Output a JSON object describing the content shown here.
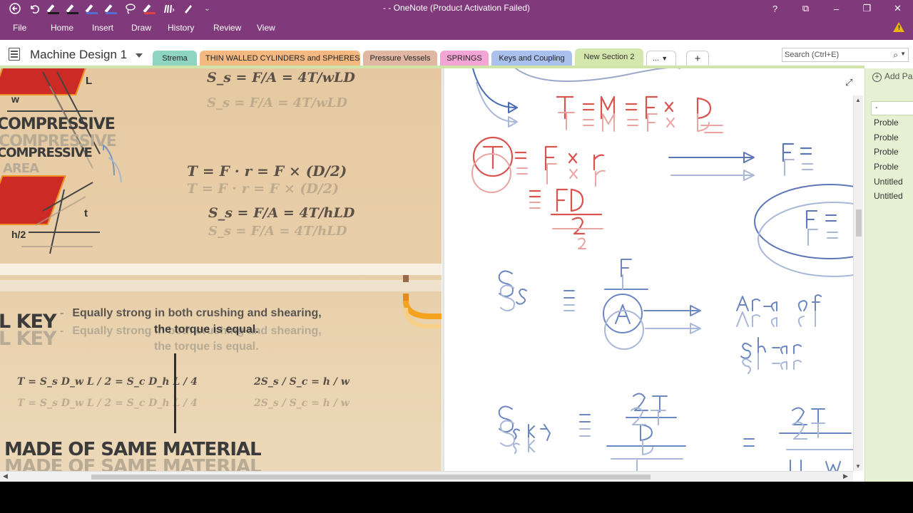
{
  "window": {
    "title": "- - OneNote (Product Activation Failed)",
    "controls": [
      "?",
      "⧉",
      "–",
      "❐",
      "✕"
    ]
  },
  "quick_access": {
    "back_icon": "back-icon",
    "undo_icon": "undo-icon",
    "pens": [
      {
        "color": "#1a1a1a"
      },
      {
        "color": "#1a1a1a"
      },
      {
        "color": "#4f6fd1"
      },
      {
        "color": "#4f6fd1"
      },
      {
        "color": "#1a1a1a"
      },
      {
        "color": "#e04040"
      }
    ]
  },
  "ribbon": {
    "tabs": [
      "File",
      "Home",
      "Insert",
      "Draw",
      "History",
      "Review",
      "View"
    ],
    "warning_icon": "warning-icon"
  },
  "notebook": {
    "name": "Machine Design 1"
  },
  "sections": [
    {
      "label": "Strema",
      "color": "#8fd3c1"
    },
    {
      "label": "THIN WALLED CYLINDERS and SPHERES",
      "color": "#f4b981"
    },
    {
      "label": "Pressure Vessels",
      "color": "#e0b7a2"
    },
    {
      "label": "SPRINGS",
      "color": "#f3a6d6"
    },
    {
      "label": "Keys and Coupling",
      "color": "#a9c1ec"
    },
    {
      "label": "New Section 2",
      "color": "#d4e8ae",
      "active": true
    }
  ],
  "section_more": "...",
  "add_section": "+",
  "search": {
    "placeholder": "Search (Ctrl+E)"
  },
  "slide": {
    "labels": {
      "compressive": "COMPRESSIVE",
      "area": "AREA",
      "key": "L KEY",
      "made_of": "MADE OF SAME MATERIAL"
    },
    "bullets": {
      "b1": "Equally strong in both crushing and shearing,",
      "b2": "the torque is equal."
    },
    "formulas": {
      "f1": "S_s = F/A = 4T/wLD",
      "torque": "T = F · r = F × (D/2)",
      "f2": "S_s = F/A = 4T/hLD",
      "t_eq": "T = S_s D_w L / 2 = S_c D_h L / 4",
      "ratio": "2S_s / S_c = h / w"
    }
  },
  "page_list": {
    "add_page": "Add Pa",
    "selected": "-",
    "pages": [
      "Proble",
      "Proble",
      "Proble",
      "Proble",
      "Untitled",
      "Untitled"
    ]
  }
}
